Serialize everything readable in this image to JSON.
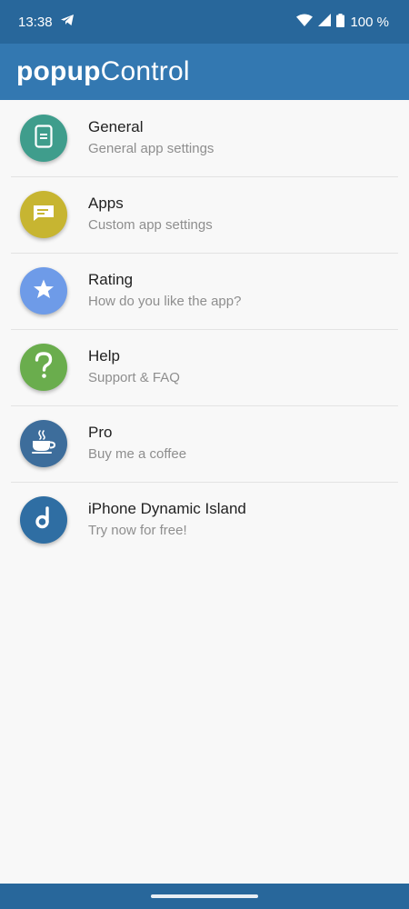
{
  "status_bar": {
    "time": "13:38",
    "battery": "100 %"
  },
  "app_bar": {
    "title_bold": "popup",
    "title_light": "Control"
  },
  "menu": {
    "items": [
      {
        "title": "General",
        "subtitle": "General app settings",
        "icon": "document-icon",
        "color": "#3f9d8c"
      },
      {
        "title": "Apps",
        "subtitle": "Custom app settings",
        "icon": "message-icon",
        "color": "#c7b531"
      },
      {
        "title": "Rating",
        "subtitle": "How do you like the app?",
        "icon": "star-icon",
        "color": "#6e9be8"
      },
      {
        "title": "Help",
        "subtitle": "Support & FAQ",
        "icon": "question-icon",
        "color": "#6aad4d"
      },
      {
        "title": "Pro",
        "subtitle": "Buy me a coffee",
        "icon": "coffee-icon",
        "color": "#3d6d9b"
      },
      {
        "title": "iPhone Dynamic Island",
        "subtitle": "Try now for free!",
        "icon": "dynamic-island-icon",
        "color": "#2f6ea3"
      }
    ]
  },
  "colors": {
    "status_bar": "#28679b",
    "app_bar": "#3378b1",
    "background": "#f8f8f8"
  }
}
